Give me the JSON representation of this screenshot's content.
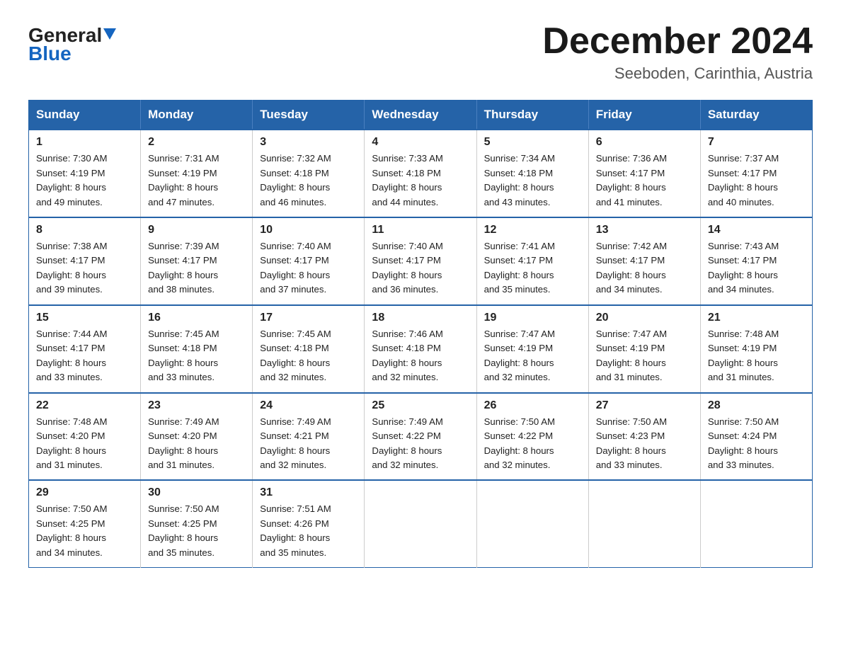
{
  "header": {
    "logo": {
      "general": "General",
      "triangle": "▲",
      "blue": "Blue"
    },
    "title": "December 2024",
    "location": "Seeboden, Carinthia, Austria"
  },
  "weekdays": [
    "Sunday",
    "Monday",
    "Tuesday",
    "Wednesday",
    "Thursday",
    "Friday",
    "Saturday"
  ],
  "weeks": [
    [
      {
        "day": "1",
        "sunrise": "7:30 AM",
        "sunset": "4:19 PM",
        "daylight": "8 hours and 49 minutes."
      },
      {
        "day": "2",
        "sunrise": "7:31 AM",
        "sunset": "4:19 PM",
        "daylight": "8 hours and 47 minutes."
      },
      {
        "day": "3",
        "sunrise": "7:32 AM",
        "sunset": "4:18 PM",
        "daylight": "8 hours and 46 minutes."
      },
      {
        "day": "4",
        "sunrise": "7:33 AM",
        "sunset": "4:18 PM",
        "daylight": "8 hours and 44 minutes."
      },
      {
        "day": "5",
        "sunrise": "7:34 AM",
        "sunset": "4:18 PM",
        "daylight": "8 hours and 43 minutes."
      },
      {
        "day": "6",
        "sunrise": "7:36 AM",
        "sunset": "4:17 PM",
        "daylight": "8 hours and 41 minutes."
      },
      {
        "day": "7",
        "sunrise": "7:37 AM",
        "sunset": "4:17 PM",
        "daylight": "8 hours and 40 minutes."
      }
    ],
    [
      {
        "day": "8",
        "sunrise": "7:38 AM",
        "sunset": "4:17 PM",
        "daylight": "8 hours and 39 minutes."
      },
      {
        "day": "9",
        "sunrise": "7:39 AM",
        "sunset": "4:17 PM",
        "daylight": "8 hours and 38 minutes."
      },
      {
        "day": "10",
        "sunrise": "7:40 AM",
        "sunset": "4:17 PM",
        "daylight": "8 hours and 37 minutes."
      },
      {
        "day": "11",
        "sunrise": "7:40 AM",
        "sunset": "4:17 PM",
        "daylight": "8 hours and 36 minutes."
      },
      {
        "day": "12",
        "sunrise": "7:41 AM",
        "sunset": "4:17 PM",
        "daylight": "8 hours and 35 minutes."
      },
      {
        "day": "13",
        "sunrise": "7:42 AM",
        "sunset": "4:17 PM",
        "daylight": "8 hours and 34 minutes."
      },
      {
        "day": "14",
        "sunrise": "7:43 AM",
        "sunset": "4:17 PM",
        "daylight": "8 hours and 34 minutes."
      }
    ],
    [
      {
        "day": "15",
        "sunrise": "7:44 AM",
        "sunset": "4:17 PM",
        "daylight": "8 hours and 33 minutes."
      },
      {
        "day": "16",
        "sunrise": "7:45 AM",
        "sunset": "4:18 PM",
        "daylight": "8 hours and 33 minutes."
      },
      {
        "day": "17",
        "sunrise": "7:45 AM",
        "sunset": "4:18 PM",
        "daylight": "8 hours and 32 minutes."
      },
      {
        "day": "18",
        "sunrise": "7:46 AM",
        "sunset": "4:18 PM",
        "daylight": "8 hours and 32 minutes."
      },
      {
        "day": "19",
        "sunrise": "7:47 AM",
        "sunset": "4:19 PM",
        "daylight": "8 hours and 32 minutes."
      },
      {
        "day": "20",
        "sunrise": "7:47 AM",
        "sunset": "4:19 PM",
        "daylight": "8 hours and 31 minutes."
      },
      {
        "day": "21",
        "sunrise": "7:48 AM",
        "sunset": "4:19 PM",
        "daylight": "8 hours and 31 minutes."
      }
    ],
    [
      {
        "day": "22",
        "sunrise": "7:48 AM",
        "sunset": "4:20 PM",
        "daylight": "8 hours and 31 minutes."
      },
      {
        "day": "23",
        "sunrise": "7:49 AM",
        "sunset": "4:20 PM",
        "daylight": "8 hours and 31 minutes."
      },
      {
        "day": "24",
        "sunrise": "7:49 AM",
        "sunset": "4:21 PM",
        "daylight": "8 hours and 32 minutes."
      },
      {
        "day": "25",
        "sunrise": "7:49 AM",
        "sunset": "4:22 PM",
        "daylight": "8 hours and 32 minutes."
      },
      {
        "day": "26",
        "sunrise": "7:50 AM",
        "sunset": "4:22 PM",
        "daylight": "8 hours and 32 minutes."
      },
      {
        "day": "27",
        "sunrise": "7:50 AM",
        "sunset": "4:23 PM",
        "daylight": "8 hours and 33 minutes."
      },
      {
        "day": "28",
        "sunrise": "7:50 AM",
        "sunset": "4:24 PM",
        "daylight": "8 hours and 33 minutes."
      }
    ],
    [
      {
        "day": "29",
        "sunrise": "7:50 AM",
        "sunset": "4:25 PM",
        "daylight": "8 hours and 34 minutes."
      },
      {
        "day": "30",
        "sunrise": "7:50 AM",
        "sunset": "4:25 PM",
        "daylight": "8 hours and 35 minutes."
      },
      {
        "day": "31",
        "sunrise": "7:51 AM",
        "sunset": "4:26 PM",
        "daylight": "8 hours and 35 minutes."
      },
      null,
      null,
      null,
      null
    ]
  ]
}
